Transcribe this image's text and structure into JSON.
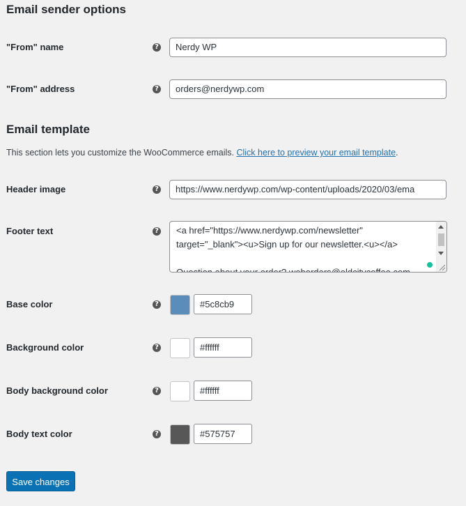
{
  "email_sender": {
    "heading": "Email sender options",
    "from_name": {
      "label": "\"From\" name",
      "value": "Nerdy WP"
    },
    "from_address": {
      "label": "\"From\" address",
      "value": "orders@nerdywp.com"
    }
  },
  "email_template": {
    "heading": "Email template",
    "description": "This section lets you customize the WooCommerce emails. ",
    "preview_link": "Click here to preview your email template",
    "description_end": ".",
    "header_image": {
      "label": "Header image",
      "value": "https://www.nerdywp.com/wp-content/uploads/2020/03/ema"
    },
    "footer_text": {
      "label": "Footer text",
      "value": "<a href=\"https://www.nerdywp.com/newsletter\"\ntarget=\"_blank\"><u>Sign up for our newsletter.<u></a>\n\nQuestion about your order? weborders@oldcitycoffee.com"
    },
    "base_color": {
      "label": "Base color",
      "value": "#5c8cb9",
      "swatch": "#5c8cb9"
    },
    "background_color": {
      "label": "Background color",
      "value": "#ffffff",
      "swatch": "#ffffff"
    },
    "body_background_color": {
      "label": "Body background color",
      "value": "#ffffff",
      "swatch": "#ffffff"
    },
    "body_text_color": {
      "label": "Body text color",
      "value": "#575757",
      "swatch": "#575757"
    }
  },
  "help_icon": "?",
  "save_label": "Save changes"
}
